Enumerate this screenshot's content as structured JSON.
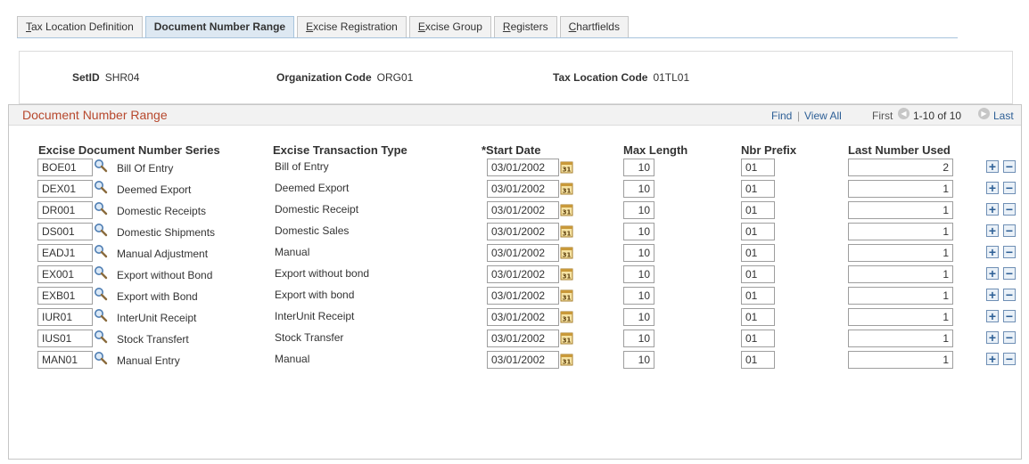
{
  "tabs": [
    {
      "label": "Tax Location Definition",
      "key": "T",
      "rest": "ax Location Definition"
    },
    {
      "label": "Document Number Range",
      "key": "",
      "rest": "Document Number Range"
    },
    {
      "label": "Excise Registration",
      "key": "E",
      "rest": "xcise Registration"
    },
    {
      "label": "Excise Group",
      "key": "E",
      "rest": "xcise Group"
    },
    {
      "label": "Registers",
      "key": "R",
      "rest": "egisters"
    },
    {
      "label": "Chartfields",
      "key": "C",
      "rest": "hartfields"
    }
  ],
  "keys": {
    "setid_label": "SetID",
    "setid_value": "SHR04",
    "org_label": "Organization Code",
    "org_value": "ORG01",
    "taxloc_label": "Tax Location Code",
    "taxloc_value": "01TL01"
  },
  "grid": {
    "title": "Document Number Range",
    "find": "Find",
    "sep": "|",
    "view_all": "View All",
    "first": "First",
    "range": "1-10 of 10",
    "last": "Last",
    "columns": {
      "series": "Excise Document Number Series",
      "txn_type": "Excise Transaction Type",
      "start_date": "*Start Date",
      "max_length": "Max Length",
      "prefix": "Nbr Prefix",
      "last_used": "Last Number Used"
    },
    "rows": [
      {
        "series": "BOE01",
        "series_desc": "Bill Of Entry",
        "txn_type": "Bill of Entry",
        "start_date": "03/01/2002",
        "max_length": "10",
        "prefix": "01",
        "last_used": "2"
      },
      {
        "series": "DEX01",
        "series_desc": "Deemed Export",
        "txn_type": "Deemed Export",
        "start_date": "03/01/2002",
        "max_length": "10",
        "prefix": "01",
        "last_used": "1"
      },
      {
        "series": "DR001",
        "series_desc": "Domestic Receipts",
        "txn_type": "Domestic Receipt",
        "start_date": "03/01/2002",
        "max_length": "10",
        "prefix": "01",
        "last_used": "1"
      },
      {
        "series": "DS001",
        "series_desc": "Domestic Shipments",
        "txn_type": "Domestic Sales",
        "start_date": "03/01/2002",
        "max_length": "10",
        "prefix": "01",
        "last_used": "1"
      },
      {
        "series": "EADJ1",
        "series_desc": "Manual Adjustment",
        "txn_type": "Manual",
        "start_date": "03/01/2002",
        "max_length": "10",
        "prefix": "01",
        "last_used": "1"
      },
      {
        "series": "EX001",
        "series_desc": "Export without Bond",
        "txn_type": "Export without bond",
        "start_date": "03/01/2002",
        "max_length": "10",
        "prefix": "01",
        "last_used": "1"
      },
      {
        "series": "EXB01",
        "series_desc": "Export with Bond",
        "txn_type": "Export with bond",
        "start_date": "03/01/2002",
        "max_length": "10",
        "prefix": "01",
        "last_used": "1"
      },
      {
        "series": "IUR01",
        "series_desc": "InterUnit Receipt",
        "txn_type": "InterUnit Receipt",
        "start_date": "03/01/2002",
        "max_length": "10",
        "prefix": "01",
        "last_used": "1"
      },
      {
        "series": "IUS01",
        "series_desc": "Stock Transfert",
        "txn_type": "Stock Transfer",
        "start_date": "03/01/2002",
        "max_length": "10",
        "prefix": "01",
        "last_used": "1"
      },
      {
        "series": "MAN01",
        "series_desc": "Manual Entry",
        "txn_type": "Manual",
        "start_date": "03/01/2002",
        "max_length": "10",
        "prefix": "01",
        "last_used": "1"
      }
    ],
    "add_symbol": "+",
    "delete_symbol": "−"
  },
  "icons": {
    "lookup": "magnifier-icon",
    "calendar": "calendar-icon",
    "first": "chevron-left-icon",
    "next": "chevron-right-icon"
  },
  "colors": {
    "title_accent": "#b7482d",
    "tab_active_bg": "#dde8f2",
    "button_blue": "#2d5f96"
  }
}
